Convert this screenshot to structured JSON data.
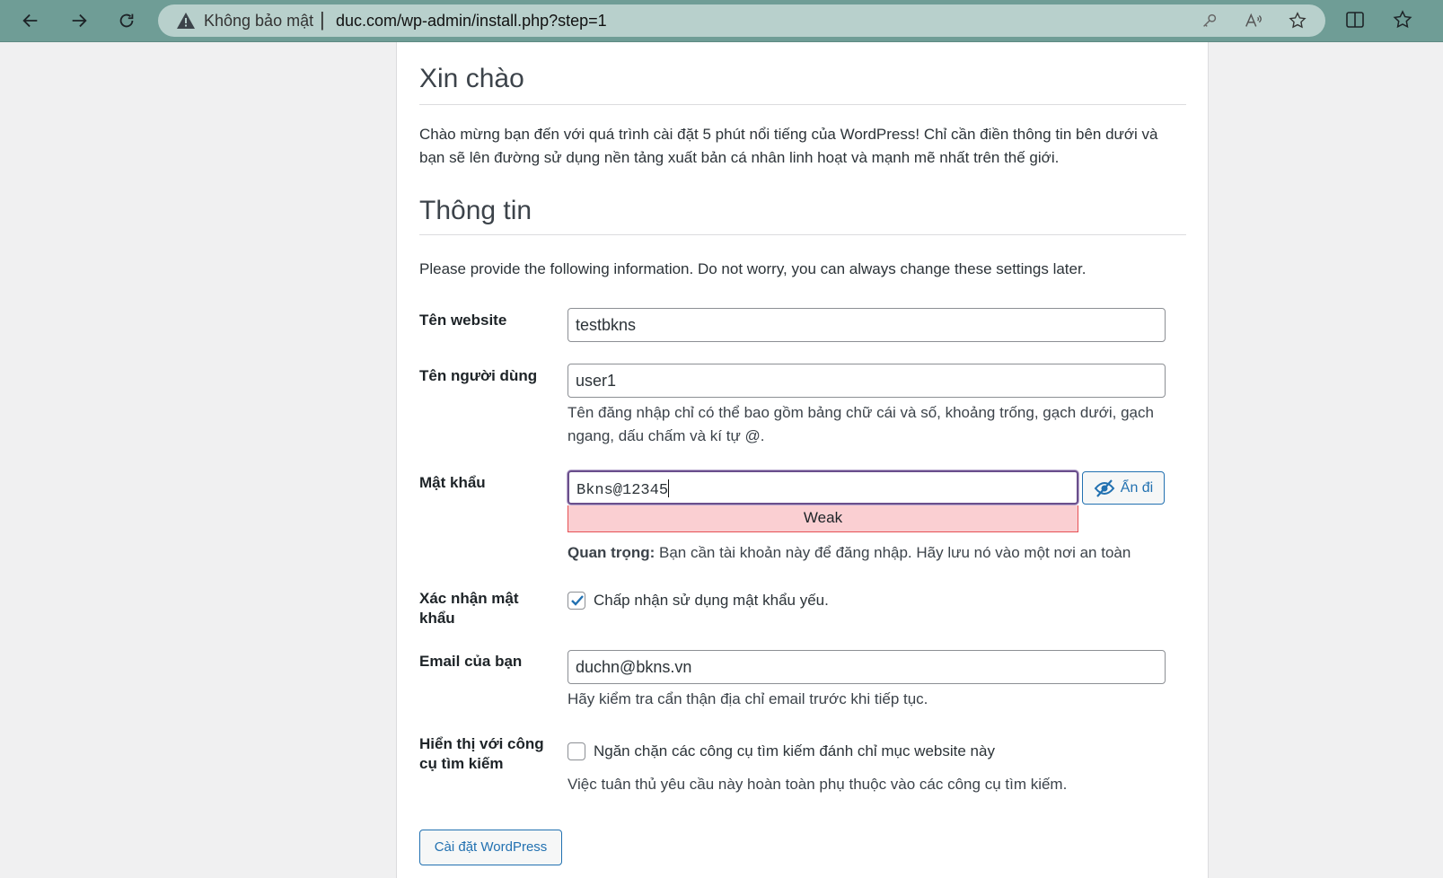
{
  "browser": {
    "security_label": "Không bảo mật",
    "separator": "|",
    "url": "duc.com/wp-admin/install.php?step=1"
  },
  "page": {
    "welcome_heading": "Xin chào",
    "welcome_text_1": "Chào mừng bạn đến với quá trình cài đặt 5 phút nổi tiếng của WordPress! Chỉ cần điền thông tin bên dưới và",
    "welcome_text_2": "bạn sẽ lên đường sử dụng nền tảng xuất bản cá nhân linh hoạt và mạnh mẽ nhất trên thế giới.",
    "info_heading": "Thông tin",
    "info_text": "Please provide the following information. Do not worry, you can always change these settings later."
  },
  "form": {
    "site_title_label": "Tên website",
    "site_title_value": "testbkns",
    "username_label": "Tên người dùng",
    "username_value": "user1",
    "username_desc_1": "Tên đăng nhập chỉ có thể bao gồm bảng chữ cái và số, khoảng trống, gạch dưới, gạch",
    "username_desc_2": "ngang, dấu chấm và kí tự @.",
    "password_label": "Mật khẩu",
    "password_value": "Bkns@12345",
    "hide_button": "Ẩn đi",
    "strength": "Weak",
    "password_important": "Quan trọng:",
    "password_note": " Bạn cần tài khoản này để đăng nhập. Hãy lưu nó vào một nơi an toàn",
    "confirm_label_1": "Xác nhận mật",
    "confirm_label_2": "khẩu",
    "confirm_checkbox": "Chấp nhận sử dụng mật khẩu yếu.",
    "confirm_checked": true,
    "email_label": "Email của bạn",
    "email_value": "duchn@bkns.vn",
    "email_desc": "Hãy kiểm tra cẩn thận địa chỉ email trước khi tiếp tục.",
    "visibility_label_1": "Hiển thị với công",
    "visibility_label_2": "cụ tìm kiếm",
    "visibility_checkbox": "Ngăn chặn các công cụ tìm kiếm đánh chỉ mục website này",
    "visibility_checked": false,
    "visibility_desc": "Việc tuân thủ yêu cầu này hoàn toàn phụ thuộc vào các công cụ tìm kiếm.",
    "submit_button": "Cài đặt WordPress"
  },
  "colors": {
    "chrome": "#6f9d96",
    "accent": "#2271b1",
    "weak_bg": "#facfd2",
    "focus": "#6a4f8c"
  },
  "icons": [
    "back-icon",
    "forward-icon",
    "refresh-icon",
    "warning-icon",
    "key-icon",
    "read-aloud-icon",
    "favorite-star-icon",
    "split-screen-icon",
    "favorites-icon",
    "eye-slash-icon",
    "checkmark-icon"
  ]
}
